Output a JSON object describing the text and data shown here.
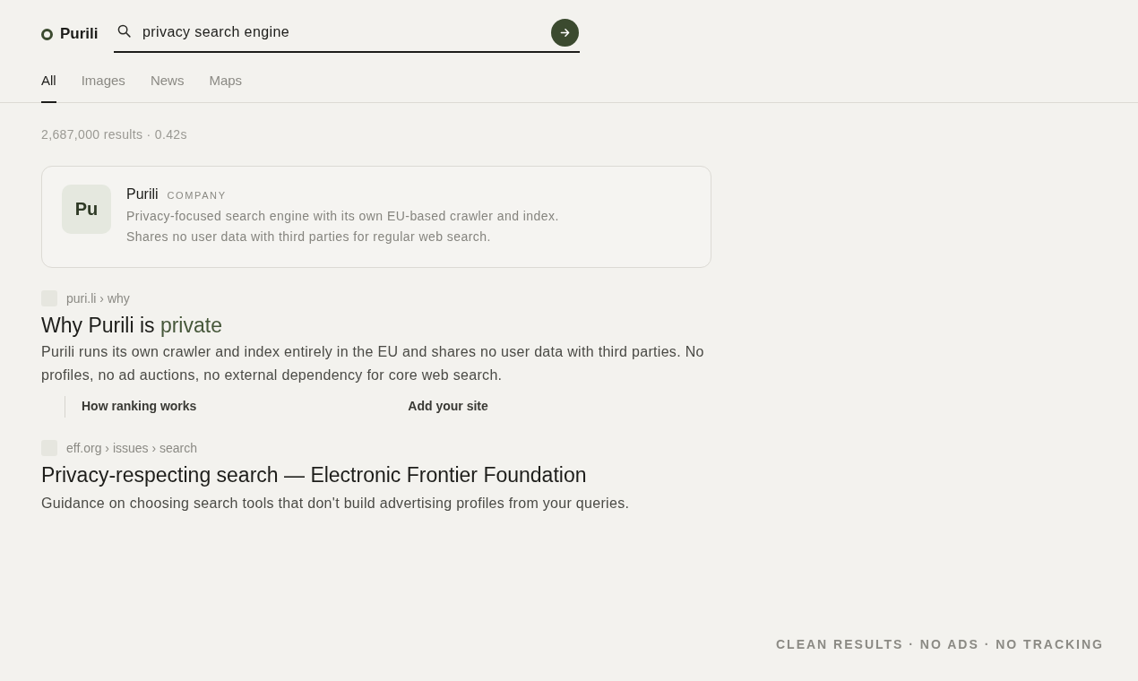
{
  "header": {
    "logo": {
      "text": "Purili"
    },
    "search": {
      "value": "privacy search engine"
    }
  },
  "tabs": [
    {
      "label": "All",
      "selected": true
    },
    {
      "label": "Images",
      "selected": false
    },
    {
      "label": "News",
      "selected": false
    },
    {
      "label": "Maps",
      "selected": false
    }
  ],
  "result_stats": "2,687,000 results · 0.42s",
  "knowledge_card": {
    "initials": "Pu",
    "title": "Purili",
    "badge": "COMPANY",
    "description": "Privacy-focused search engine with its own EU-based crawler and index. Shares no user data with third parties for regular web search."
  },
  "results": [
    {
      "breadcrumb": "puri.li › why",
      "title": [
        {
          "text": "Why Purili is ",
          "highlight": false
        },
        {
          "text": "private",
          "highlight": true
        }
      ],
      "snippet": "Purili runs its own crawler and index entirely in the EU and shares no user data with third parties. No profiles, no ad auctions, no external dependency for core web search.",
      "sitelinks": [
        "How ranking works",
        "Add your site"
      ]
    },
    {
      "breadcrumb": "eff.org › issues › search",
      "title": [
        {
          "text": "Privacy-respecting search — Electronic Frontier Foundation",
          "highlight": false
        }
      ],
      "snippet": "Guidance on choosing search tools that don't build advertising profiles from your queries."
    }
  ],
  "footer": "CLEAN RESULTS · NO ADS · NO TRACKING"
}
